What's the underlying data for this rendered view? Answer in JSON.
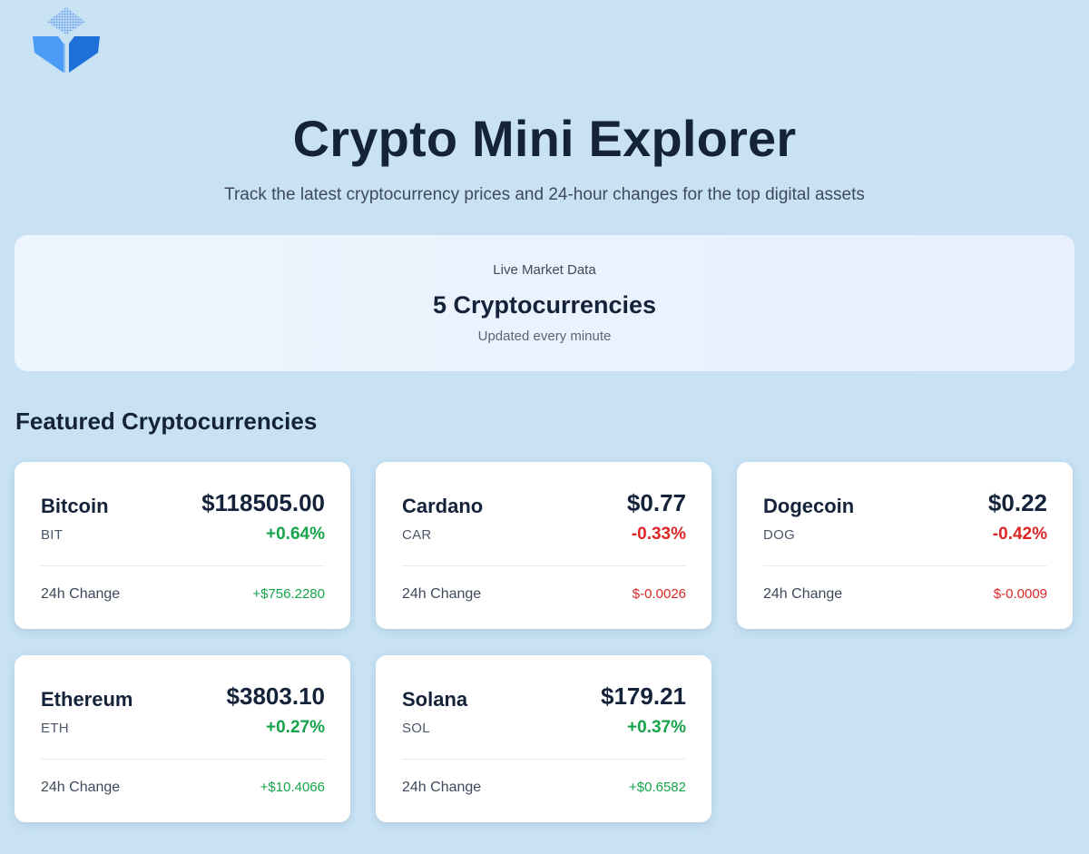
{
  "logo": {
    "icon": "cube-logo-icon",
    "colors": [
      "#3b8ef3",
      "#1f6fd8",
      "#7fb3ee"
    ]
  },
  "header": {
    "title": "Crypto Mini Explorer",
    "subtitle": "Track the latest cryptocurrency prices and 24-hour changes for the top digital assets"
  },
  "summary": {
    "label": "Live Market Data",
    "value": "5 Cryptocurrencies",
    "note": "Updated every minute"
  },
  "section": {
    "title": "Featured Cryptocurrencies"
  },
  "colors": {
    "positive": "#16a34a",
    "negative": "#dc2626",
    "background": "#c8e2f4"
  },
  "cryptos": [
    {
      "name": "Bitcoin",
      "symbol": "BIT",
      "price": "$118505.00",
      "change_pct": "+0.64%",
      "change_label": "24h Change",
      "change_abs": "+$756.2280",
      "direction": "up"
    },
    {
      "name": "Cardano",
      "symbol": "CAR",
      "price": "$0.77",
      "change_pct": "-0.33%",
      "change_label": "24h Change",
      "change_abs": "$-0.0026",
      "direction": "down"
    },
    {
      "name": "Dogecoin",
      "symbol": "DOG",
      "price": "$0.22",
      "change_pct": "-0.42%",
      "change_label": "24h Change",
      "change_abs": "$-0.0009",
      "direction": "down"
    },
    {
      "name": "Ethereum",
      "symbol": "ETH",
      "price": "$3803.10",
      "change_pct": "+0.27%",
      "change_label": "24h Change",
      "change_abs": "+$10.4066",
      "direction": "up"
    },
    {
      "name": "Solana",
      "symbol": "SOL",
      "price": "$179.21",
      "change_pct": "+0.37%",
      "change_label": "24h Change",
      "change_abs": "+$0.6582",
      "direction": "up"
    }
  ]
}
